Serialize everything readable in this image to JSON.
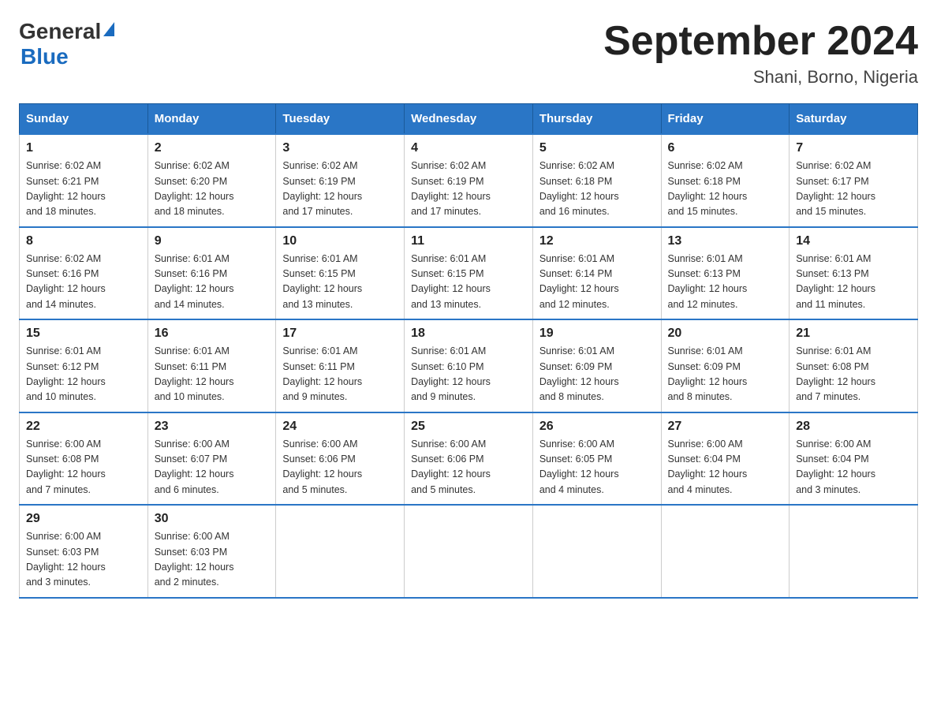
{
  "header": {
    "logo_general": "General",
    "logo_blue": "Blue",
    "title": "September 2024",
    "subtitle": "Shani, Borno, Nigeria"
  },
  "days_of_week": [
    "Sunday",
    "Monday",
    "Tuesday",
    "Wednesday",
    "Thursday",
    "Friday",
    "Saturday"
  ],
  "weeks": [
    [
      {
        "day": "1",
        "sunrise": "6:02 AM",
        "sunset": "6:21 PM",
        "daylight": "12 hours and 18 minutes."
      },
      {
        "day": "2",
        "sunrise": "6:02 AM",
        "sunset": "6:20 PM",
        "daylight": "12 hours and 18 minutes."
      },
      {
        "day": "3",
        "sunrise": "6:02 AM",
        "sunset": "6:19 PM",
        "daylight": "12 hours and 17 minutes."
      },
      {
        "day": "4",
        "sunrise": "6:02 AM",
        "sunset": "6:19 PM",
        "daylight": "12 hours and 17 minutes."
      },
      {
        "day": "5",
        "sunrise": "6:02 AM",
        "sunset": "6:18 PM",
        "daylight": "12 hours and 16 minutes."
      },
      {
        "day": "6",
        "sunrise": "6:02 AM",
        "sunset": "6:18 PM",
        "daylight": "12 hours and 15 minutes."
      },
      {
        "day": "7",
        "sunrise": "6:02 AM",
        "sunset": "6:17 PM",
        "daylight": "12 hours and 15 minutes."
      }
    ],
    [
      {
        "day": "8",
        "sunrise": "6:02 AM",
        "sunset": "6:16 PM",
        "daylight": "12 hours and 14 minutes."
      },
      {
        "day": "9",
        "sunrise": "6:01 AM",
        "sunset": "6:16 PM",
        "daylight": "12 hours and 14 minutes."
      },
      {
        "day": "10",
        "sunrise": "6:01 AM",
        "sunset": "6:15 PM",
        "daylight": "12 hours and 13 minutes."
      },
      {
        "day": "11",
        "sunrise": "6:01 AM",
        "sunset": "6:15 PM",
        "daylight": "12 hours and 13 minutes."
      },
      {
        "day": "12",
        "sunrise": "6:01 AM",
        "sunset": "6:14 PM",
        "daylight": "12 hours and 12 minutes."
      },
      {
        "day": "13",
        "sunrise": "6:01 AM",
        "sunset": "6:13 PM",
        "daylight": "12 hours and 12 minutes."
      },
      {
        "day": "14",
        "sunrise": "6:01 AM",
        "sunset": "6:13 PM",
        "daylight": "12 hours and 11 minutes."
      }
    ],
    [
      {
        "day": "15",
        "sunrise": "6:01 AM",
        "sunset": "6:12 PM",
        "daylight": "12 hours and 10 minutes."
      },
      {
        "day": "16",
        "sunrise": "6:01 AM",
        "sunset": "6:11 PM",
        "daylight": "12 hours and 10 minutes."
      },
      {
        "day": "17",
        "sunrise": "6:01 AM",
        "sunset": "6:11 PM",
        "daylight": "12 hours and 9 minutes."
      },
      {
        "day": "18",
        "sunrise": "6:01 AM",
        "sunset": "6:10 PM",
        "daylight": "12 hours and 9 minutes."
      },
      {
        "day": "19",
        "sunrise": "6:01 AM",
        "sunset": "6:09 PM",
        "daylight": "12 hours and 8 minutes."
      },
      {
        "day": "20",
        "sunrise": "6:01 AM",
        "sunset": "6:09 PM",
        "daylight": "12 hours and 8 minutes."
      },
      {
        "day": "21",
        "sunrise": "6:01 AM",
        "sunset": "6:08 PM",
        "daylight": "12 hours and 7 minutes."
      }
    ],
    [
      {
        "day": "22",
        "sunrise": "6:00 AM",
        "sunset": "6:08 PM",
        "daylight": "12 hours and 7 minutes."
      },
      {
        "day": "23",
        "sunrise": "6:00 AM",
        "sunset": "6:07 PM",
        "daylight": "12 hours and 6 minutes."
      },
      {
        "day": "24",
        "sunrise": "6:00 AM",
        "sunset": "6:06 PM",
        "daylight": "12 hours and 5 minutes."
      },
      {
        "day": "25",
        "sunrise": "6:00 AM",
        "sunset": "6:06 PM",
        "daylight": "12 hours and 5 minutes."
      },
      {
        "day": "26",
        "sunrise": "6:00 AM",
        "sunset": "6:05 PM",
        "daylight": "12 hours and 4 minutes."
      },
      {
        "day": "27",
        "sunrise": "6:00 AM",
        "sunset": "6:04 PM",
        "daylight": "12 hours and 4 minutes."
      },
      {
        "day": "28",
        "sunrise": "6:00 AM",
        "sunset": "6:04 PM",
        "daylight": "12 hours and 3 minutes."
      }
    ],
    [
      {
        "day": "29",
        "sunrise": "6:00 AM",
        "sunset": "6:03 PM",
        "daylight": "12 hours and 3 minutes."
      },
      {
        "day": "30",
        "sunrise": "6:00 AM",
        "sunset": "6:03 PM",
        "daylight": "12 hours and 2 minutes."
      },
      null,
      null,
      null,
      null,
      null
    ]
  ],
  "labels": {
    "sunrise": "Sunrise:",
    "sunset": "Sunset:",
    "daylight": "Daylight:"
  }
}
